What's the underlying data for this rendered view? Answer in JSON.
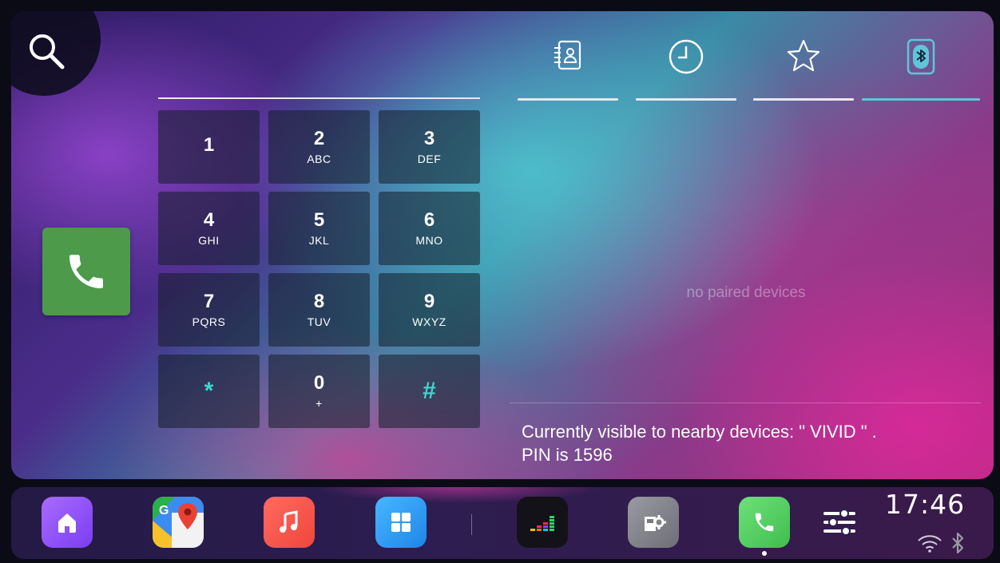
{
  "keypad": {
    "keys": [
      {
        "digit": "1",
        "letters": ""
      },
      {
        "digit": "2",
        "letters": "ABC"
      },
      {
        "digit": "3",
        "letters": "DEF"
      },
      {
        "digit": "4",
        "letters": "GHI"
      },
      {
        "digit": "5",
        "letters": "JKL"
      },
      {
        "digit": "6",
        "letters": "MNO"
      },
      {
        "digit": "7",
        "letters": "PQRS"
      },
      {
        "digit": "8",
        "letters": "TUV"
      },
      {
        "digit": "9",
        "letters": "WXYZ"
      },
      {
        "digit": "*",
        "letters": ""
      },
      {
        "digit": "0",
        "letters": "+"
      },
      {
        "digit": "#",
        "letters": ""
      }
    ]
  },
  "tabs": [
    {
      "icon": "contacts-icon",
      "active": false
    },
    {
      "icon": "recents-clock-icon",
      "active": false
    },
    {
      "icon": "favorites-star-icon",
      "active": false
    },
    {
      "icon": "bluetooth-icon",
      "active": true
    }
  ],
  "bluetooth": {
    "empty_message": "no paired devices",
    "visible_line1": "Currently visible to nearby devices: \" VIVID \" .",
    "visible_line2": "PIN is 1596"
  },
  "dock": {
    "apps": [
      "home-app-icon",
      "google-maps-app-icon",
      "music-app-icon",
      "app-grid-icon",
      "deezer-app-icon",
      "car-settings-app-icon",
      "phone-app-icon",
      "equalizer-settings-icon"
    ],
    "active_app": "phone-app-icon"
  },
  "status": {
    "time": "17:46",
    "icons": [
      "wifi-icon",
      "bluetooth-status-icon"
    ]
  },
  "colors": {
    "call_button": "#4c9a4a",
    "accent": "#5fc6d8",
    "special_key": "#3fd6d0"
  }
}
